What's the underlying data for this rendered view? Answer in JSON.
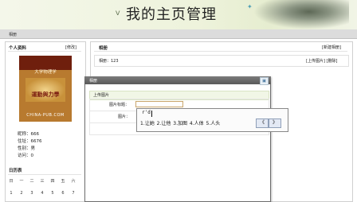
{
  "header": {
    "title": "我的主页管理"
  },
  "nav": {
    "home": "相册"
  },
  "profile": {
    "heading": "个人资料",
    "modify": "[修改]",
    "avatar_lines": [
      "大学物理学",
      "運動與力學",
      "CHINA-PUB.COM"
    ],
    "info": [
      "昵称：666",
      "住址：6676",
      "性别：男",
      "访问：0"
    ]
  },
  "calendar": {
    "heading": "日历表",
    "weekdays": [
      "日",
      "一",
      "二",
      "三",
      "四",
      "五",
      "六"
    ],
    "days": [
      "1",
      "2",
      "3",
      "4",
      "5",
      "6",
      "7"
    ]
  },
  "album": {
    "heading": "相册",
    "new_album": "[新建相册]",
    "label": "相册：123",
    "actions": "[上传图片] [删除]"
  },
  "dialog": {
    "title": "相册",
    "close": "▣",
    "upload_heading": "上传图片",
    "name_label": "图片标题：",
    "pic_label": "图片："
  },
  "ime": {
    "pinyin": "r'd",
    "candidates": "1.让她  2.让他  3.加图  4.人体  5.人头",
    "prev": "《",
    "next": "》"
  }
}
